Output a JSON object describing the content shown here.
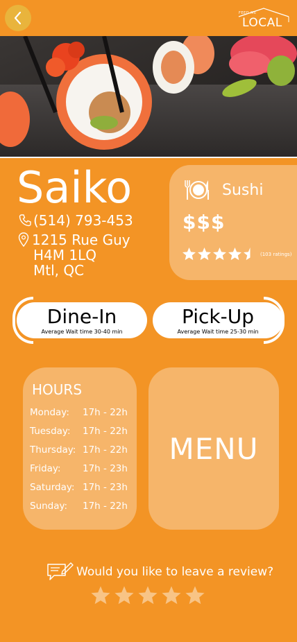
{
  "header": {
    "back_icon": "chevron-left-icon",
    "logo_small": "FEED ME",
    "logo_big": "LOCAL"
  },
  "restaurant": {
    "name": "Saiko",
    "phone": "(514) 793-453",
    "address_lines": [
      "1215 Rue Guy",
      "H4M 1LQ",
      "Mtl, QC"
    ]
  },
  "info": {
    "cuisine": "Sushi",
    "price": "$$$",
    "rating_value": 4.5,
    "rating_max": 5,
    "rating_count": "(103 ratings)"
  },
  "modes": {
    "dine_in": {
      "label": "Dine-In",
      "wait": "Average Wait time 30-40 min"
    },
    "pick_up": {
      "label": "Pick-Up",
      "wait": "Average Wait time 25-30 min"
    }
  },
  "hours": {
    "title": "HOURS",
    "rows": [
      {
        "day": "Monday:",
        "time": "17h - 22h"
      },
      {
        "day": "Tuesday:",
        "time": "17h - 22h"
      },
      {
        "day": "Thursday:",
        "time": "17h - 22h"
      },
      {
        "day": "Friday:",
        "time": "17h - 23h"
      },
      {
        "day": "Saturday:",
        "time": "17h - 23h"
      },
      {
        "day": "Sunday:",
        "time": "17h - 22h"
      }
    ]
  },
  "menu": {
    "label": "MENU"
  },
  "review": {
    "prompt": "Would you like to leave a review?",
    "stars_max": 5
  },
  "colors": {
    "background": "#F39425",
    "card": "#F6B56A",
    "back_button": "#E9B43C",
    "review_star": "#F8C486"
  }
}
